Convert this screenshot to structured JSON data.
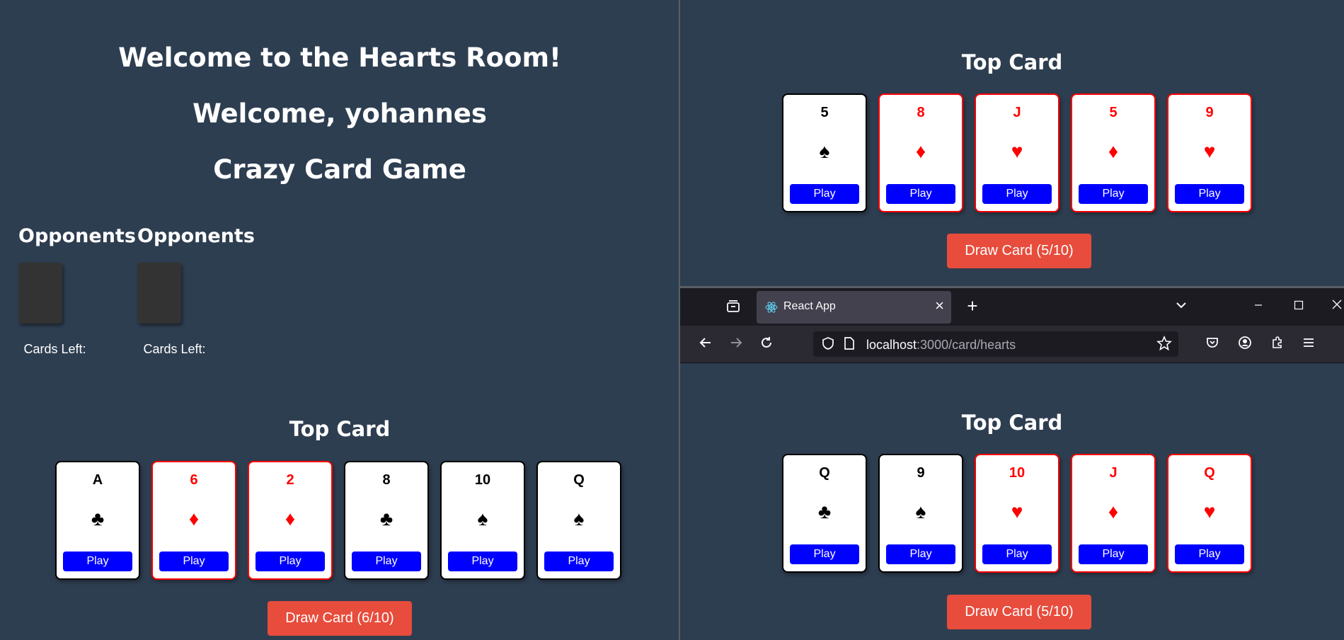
{
  "left": {
    "welcome_room": "Welcome to the Hearts Room!",
    "welcome_user": "Welcome, yohannes",
    "game_title": "Crazy Card Game",
    "opponents": [
      {
        "title": "Opponents",
        "cards_left": "Cards Left:"
      },
      {
        "title": "Opponents",
        "cards_left": "Cards Left:"
      }
    ],
    "top_card_title": "Top Card",
    "hand": [
      {
        "rank": "A",
        "suit": "♣",
        "color": "black",
        "play": "Play"
      },
      {
        "rank": "6",
        "suit": "♦",
        "color": "red",
        "play": "Play"
      },
      {
        "rank": "2",
        "suit": "♦",
        "color": "red",
        "play": "Play"
      },
      {
        "rank": "8",
        "suit": "♣",
        "color": "black",
        "play": "Play"
      },
      {
        "rank": "10",
        "suit": "♠",
        "color": "black",
        "play": "Play"
      },
      {
        "rank": "Q",
        "suit": "♠",
        "color": "black",
        "play": "Play"
      }
    ],
    "draw_label": "Draw Card (6/10)"
  },
  "top_right": {
    "top_card_title": "Top Card",
    "hand": [
      {
        "rank": "5",
        "suit": "♠",
        "color": "black",
        "play": "Play"
      },
      {
        "rank": "8",
        "suit": "♦",
        "color": "red",
        "play": "Play"
      },
      {
        "rank": "J",
        "suit": "♥",
        "color": "red",
        "play": "Play"
      },
      {
        "rank": "5",
        "suit": "♦",
        "color": "red",
        "play": "Play"
      },
      {
        "rank": "9",
        "suit": "♥",
        "color": "red",
        "play": "Play"
      }
    ],
    "draw_label": "Draw Card (5/10)"
  },
  "browser": {
    "tab_title": "React App",
    "url_host": "localhost",
    "url_path": ":3000/card/hearts"
  },
  "bottom_right": {
    "top_card_title": "Top Card",
    "hand": [
      {
        "rank": "Q",
        "suit": "♣",
        "color": "black",
        "play": "Play"
      },
      {
        "rank": "9",
        "suit": "♠",
        "color": "black",
        "play": "Play"
      },
      {
        "rank": "10",
        "suit": "♥",
        "color": "red",
        "play": "Play"
      },
      {
        "rank": "J",
        "suit": "♦",
        "color": "red",
        "play": "Play"
      },
      {
        "rank": "Q",
        "suit": "♥",
        "color": "red",
        "play": "Play"
      }
    ],
    "draw_label": "Draw Card (5/10)"
  },
  "colors": {
    "background": "#2e3e51",
    "play_button": "#0000ff",
    "draw_button": "#e74c3c",
    "red_suit": "#ff0000"
  },
  "icons": [
    "react-icon",
    "tab-close-icon",
    "new-tab-icon",
    "list-tabs-icon",
    "minimize-icon",
    "maximize-icon",
    "close-window-icon",
    "back-icon",
    "forward-icon",
    "reload-icon",
    "shield-icon",
    "page-icon",
    "bookmark-star-icon",
    "pocket-icon",
    "account-icon",
    "extensions-icon",
    "menu-icon",
    "tab-collections-icon"
  ]
}
